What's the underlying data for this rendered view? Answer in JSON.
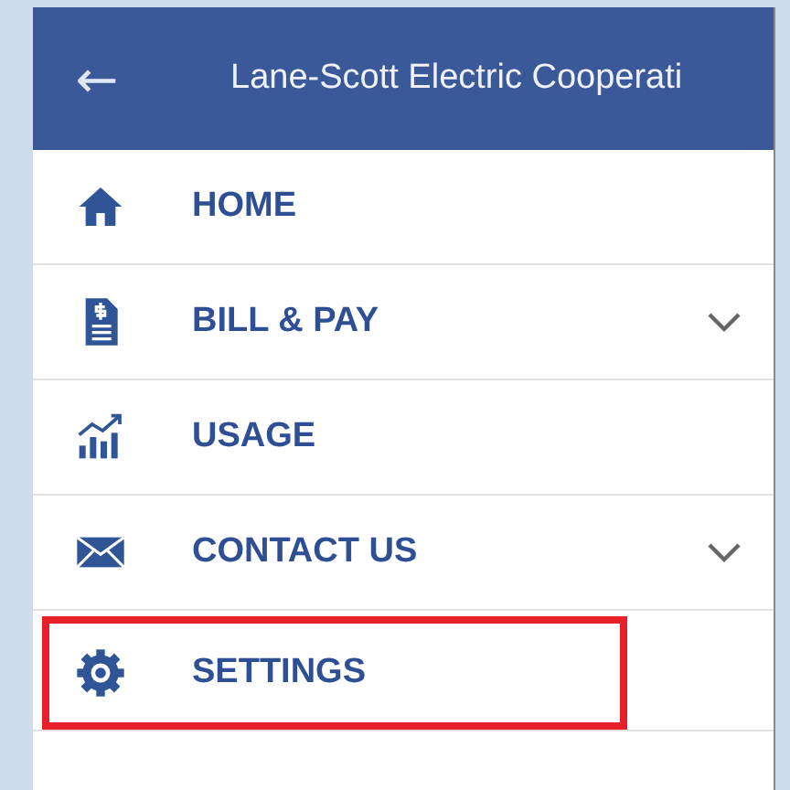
{
  "header": {
    "back_icon": "←",
    "title": "Lane-Scott Electric Cooperati"
  },
  "menu": [
    {
      "label": "HOME",
      "has_submenu": false,
      "highlighted": false
    },
    {
      "label": "BILL & PAY",
      "has_submenu": true,
      "highlighted": false
    },
    {
      "label": "USAGE",
      "has_submenu": false,
      "highlighted": false
    },
    {
      "label": "CONTACT US",
      "has_submenu": true,
      "highlighted": false
    },
    {
      "label": "SETTINGS",
      "has_submenu": false,
      "highlighted": true
    }
  ]
}
